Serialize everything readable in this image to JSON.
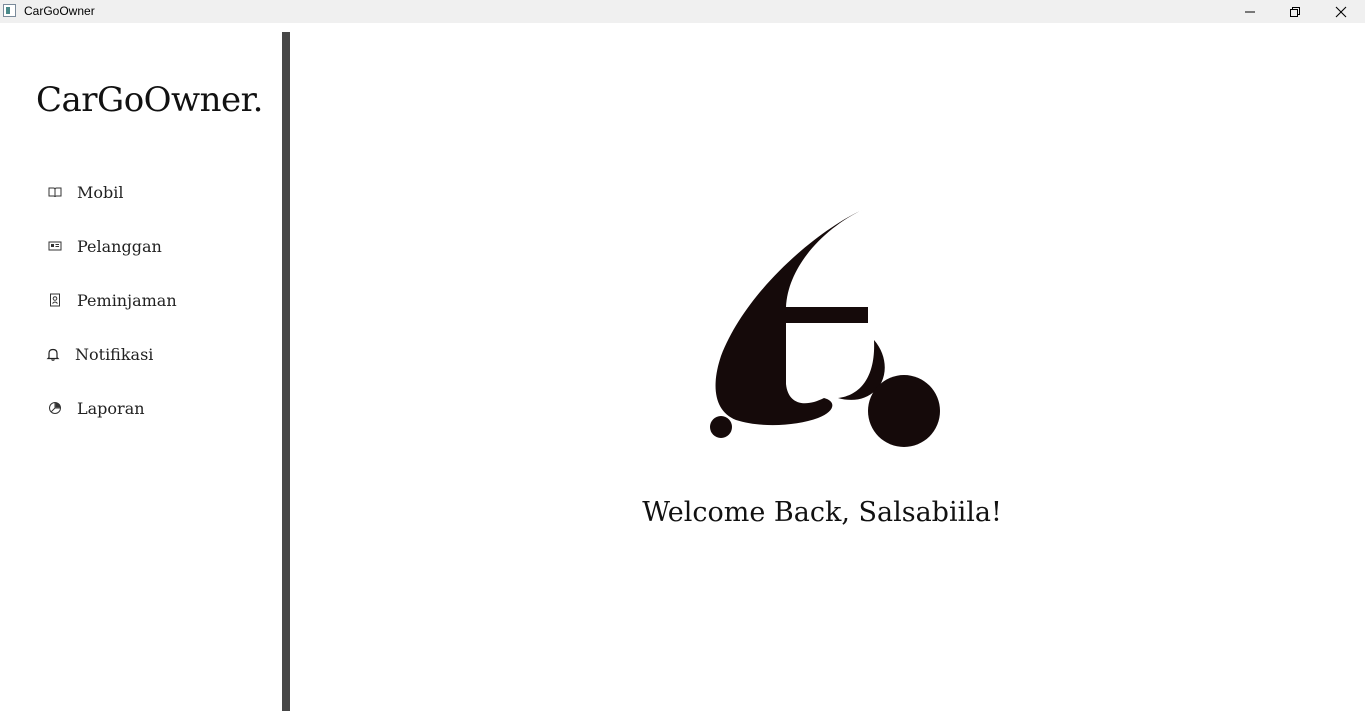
{
  "window": {
    "title": "CarGoOwner"
  },
  "sidebar": {
    "brand": "CarGoOwner.",
    "items": [
      {
        "label": "Mobil",
        "icon": "book-open-icon"
      },
      {
        "label": "Pelanggan",
        "icon": "id-card-icon"
      },
      {
        "label": "Peminjaman",
        "icon": "badge-person-icon"
      },
      {
        "label": "Notifikasi",
        "icon": "bell-icon"
      },
      {
        "label": "Laporan",
        "icon": "pie-chart-icon"
      }
    ]
  },
  "main": {
    "welcome": "Welcome Back, Salsabiila!",
    "logo_icon": "cargo-logo-icon"
  },
  "colors": {
    "divider": "#474747",
    "logo": "#150a0a",
    "titlebar": "#f0f0f0"
  }
}
